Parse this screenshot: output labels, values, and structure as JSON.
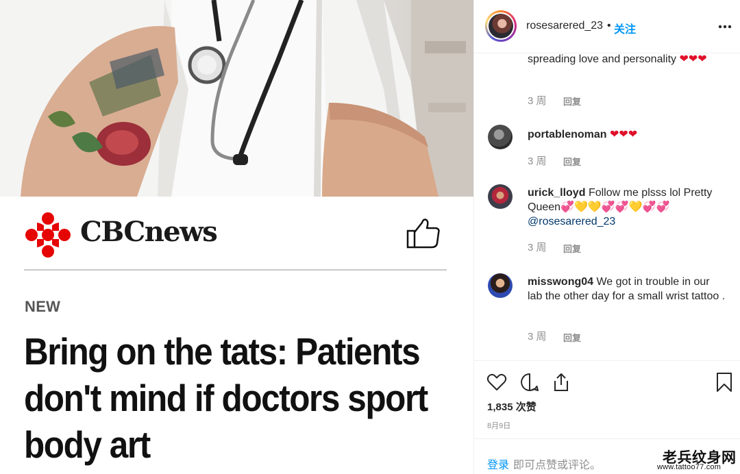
{
  "post": {
    "brand": "CBCnews",
    "kicker": "NEW",
    "headline": "Bring on the tats: Patients don't mind if doctors sport body art"
  },
  "header": {
    "username": "rosesarered_23",
    "separator": "•",
    "follow_label": "关注"
  },
  "comments": [
    {
      "username": "",
      "text": "spreading love and personality",
      "emoji": "❤❤❤",
      "time": "3 周",
      "reply": "回复"
    },
    {
      "username": "portablenoman",
      "text": "",
      "emoji": "❤❤❤",
      "time": "3 周",
      "reply": "回复"
    },
    {
      "username": "urick_lloyd",
      "text": "Follow me plsss lol Pretty Queen",
      "emoji": "💞💛💛💞💞💛💞💞",
      "mention": "@rosesarered_23",
      "time": "3 周",
      "reply": "回复"
    },
    {
      "username": "misswong04",
      "text": "We got in trouble in our lab the other day for a small wrist tattoo .",
      "time": "3 周",
      "reply": "回复"
    }
  ],
  "actions": {
    "likes": "1,835 次赞",
    "date": "8月9日"
  },
  "login": {
    "link": "登录",
    "rest": "即可点赞或评论。"
  },
  "watermark": {
    "title": "老兵纹身网",
    "url": "www.tattoo77.com"
  },
  "colors": {
    "link_blue": "#0095f6",
    "cbc_red": "#e60505",
    "heart_red": "#e0102a",
    "muted": "#8e8e8e"
  },
  "icons": [
    "more-icon",
    "heart-icon",
    "comment-icon",
    "share-icon",
    "bookmark-icon",
    "thumbs-up-icon",
    "cbc-gem-logo"
  ]
}
